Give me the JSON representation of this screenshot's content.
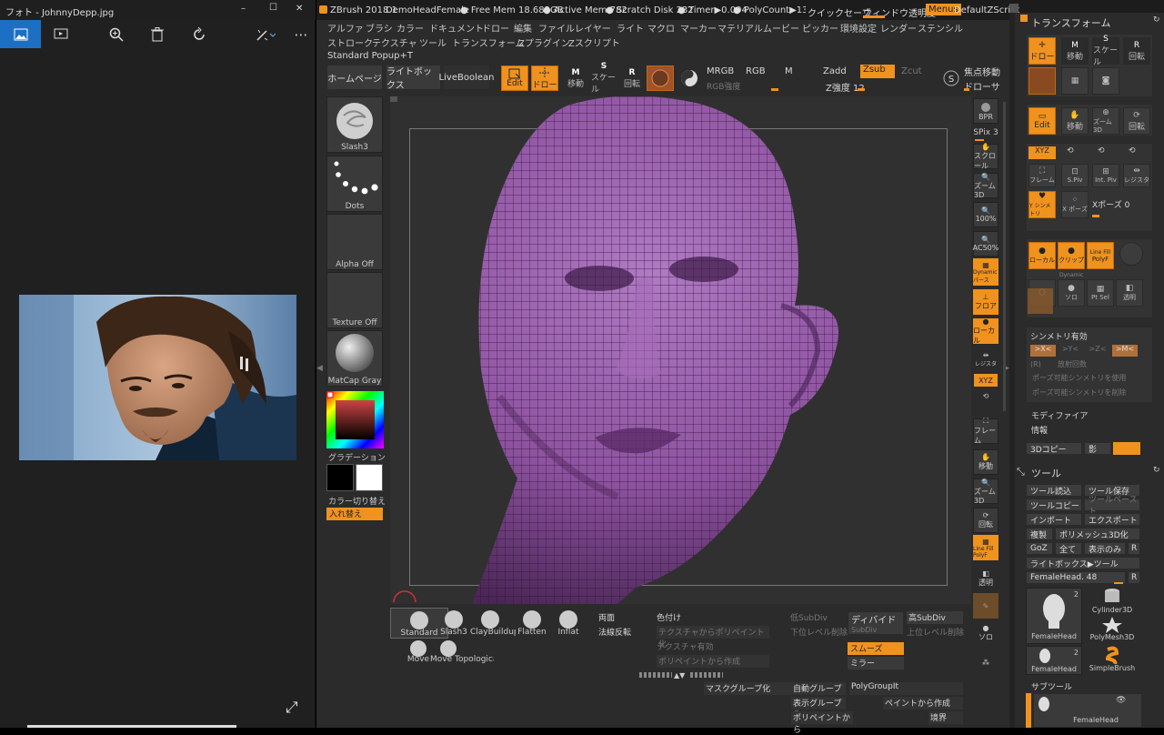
{
  "photos": {
    "title": "フォト - JohnnyDepp.jpg",
    "win_controls": [
      "–",
      "☐",
      "✕"
    ],
    "tools": [
      "image-icon",
      "slideshow-icon",
      "zoom-icon",
      "delete-icon",
      "rotate-icon",
      "edit-icon",
      "more-icon"
    ],
    "expand": "⤢"
  },
  "zbrush": {
    "title": "ZBrush 2018.1",
    "doc": "DemoHeadFemale",
    "free_mem": "● Free Mem 18.682GB",
    "active_mem": "● Active Mem 782",
    "scratch": "● Scratch Disk 232",
    "timer": "● Timer▶0.004",
    "polycount": "● PolyCount▶13.06(",
    "quicksave": "クイックセーブ",
    "transparency": "ウィンドウ透明度",
    "menus": "Menus",
    "script": "DefaultZScript",
    "menu_row1": [
      "アルファ",
      "ブラシ",
      "カラー",
      "ドキュメント",
      "ドロー",
      "編集",
      "ファイル",
      "レイヤー",
      "ライト",
      "マクロ",
      "マーカー",
      "マテリアル",
      "ムービー",
      "ピッカー",
      "環境設定",
      "レンダー",
      "ステンシル"
    ],
    "menu_row2": [
      "ストローク",
      "テクスチャ",
      "ツール",
      "トランスフォーム",
      "Zプラグイン",
      "Zスクリプト"
    ],
    "popup": "Standard Popup+T",
    "home": "ホームページ",
    "lightbox": "ライトボックス",
    "liveboolean": "LiveBoolean",
    "top_tools": {
      "edit": "Edit",
      "draw": "ドロー",
      "move": "移動",
      "scale": "スケール",
      "rotate": "回転"
    },
    "mrgb": "MRGB",
    "rgb": "RGB",
    "m": "M",
    "rgb_intensity": "RGB強度",
    "zadd": "Zadd",
    "zsub": "Zsub",
    "zcut": "Zcut",
    "z_intensity": "Z強度 12",
    "focal": "焦点移動",
    "draw_size": "ドローサ",
    "left_shelf": {
      "slash": "Slash3",
      "dots": "Dots",
      "alpha": "Alpha Off",
      "texture": "Texture Off",
      "matcap": "MatCap Gray",
      "gradient": "グラデーション",
      "color_switch": "カラー切り替え",
      "swap": "入れ替え"
    },
    "right_rail": [
      "BPR",
      "SPix 3",
      "スクロール",
      "ズーム3D",
      "100%",
      "AC50%",
      "Dynamic パース",
      "フロア",
      "ローカル",
      "レジスタ",
      "XYZ",
      "フレーム",
      "移動",
      "ズーム3D",
      "回転",
      "Line Fill PolyF",
      "透明",
      "ゴースト",
      "ソロ",
      "シャム"
    ],
    "bottom_brushes": [
      "Standard",
      "Slash3",
      "ClayBuildup",
      "Flatten",
      "Inflat",
      "Move",
      "Move Topologica"
    ],
    "bottom_left": [
      "両面",
      "法線反転"
    ],
    "bottom_mid": [
      "色付け",
      "テクスチャからポリペイント化",
      "テクスチャ有効",
      "ポリペイントから作成"
    ],
    "subdiv": [
      "低SubDiv",
      "下位レベル削除"
    ],
    "divide": "ディバイド",
    "subdiv_label": "SubDiv",
    "subdiv_high": [
      "高SubDiv",
      "上位レベル削除"
    ],
    "smooth": "スムーズ",
    "mirror": "ミラー",
    "groups": [
      "マスクグループ化",
      "自動グループ",
      "PolyGroupIt",
      "表示グループ化",
      "ペイントから作成",
      "ポリペイントから",
      "境界"
    ],
    "transform_title": "トランスフォーム",
    "transform_btns": [
      "ドロー",
      "移動",
      "スケール",
      "回転"
    ],
    "transform_row2": [
      "Edit",
      "移動",
      "ズーム3D",
      "回転"
    ],
    "transform_xyz": "XYZ",
    "transform_row3": [
      "フレーム",
      "S.Piv",
      "Int. Piv",
      "レジスタ"
    ],
    "transform_row4": [
      "Y シンメトリ",
      "X ポーズ"
    ],
    "xpose": "Xポーズ 0",
    "transform_row5": [
      "ローカル",
      "クリップ",
      "PolyF",
      "Line Fill"
    ],
    "transform_row6": [
      "ソロ",
      "Pt Sel",
      "透明"
    ],
    "dynamic": "Dynamic",
    "symmetry_title": "シンメトリ有効",
    "sym_axes": [
      ">X<",
      ">Y<",
      ">Z<",
      ">M<"
    ],
    "radial": "(R)",
    "radial_count": "放射回数",
    "sym_pose": "ポーズ可能シンメトリを使用",
    "sym_pose_del": "ポーズ可能シンメトリを削除",
    "modifier": "モディファイア",
    "info": "情報",
    "copy3d": "3Dコピー",
    "shadow": "影",
    "tool_title": "ツール",
    "tool_btns": [
      "ツール読込",
      "ツール保存",
      "ツールコピー",
      "ツールペースト",
      "インポート",
      "エクスポート",
      "複製",
      "ポリメッシュ3D化",
      "GoZ",
      "全て",
      "表示のみ",
      "R"
    ],
    "lightbox_tool": "ライトボックス▶ツール",
    "female_head": "FemaleHead. 48",
    "tool_thumbs": [
      {
        "name": "FemaleHead",
        "count": "2"
      },
      {
        "name": "Cylinder3D",
        "count": ""
      },
      {
        "name": "PolyMesh3D",
        "count": ""
      },
      {
        "name": "FemaleHead",
        "count": "2"
      },
      {
        "name": "SimpleBrush",
        "count": ""
      }
    ],
    "subtool": "サブツール",
    "subtool_item": "FemaleHead"
  },
  "colors": {
    "accent": "#f0921e",
    "mesh": "#9b5cae",
    "panel": "#333333"
  }
}
